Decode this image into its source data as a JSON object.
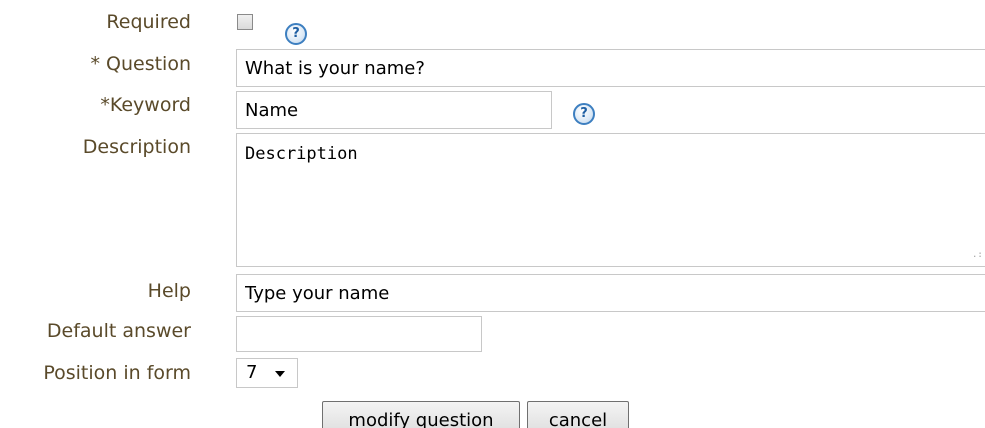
{
  "form": {
    "required": {
      "label": "Required",
      "checked": false,
      "help_icon": "question-icon"
    },
    "question": {
      "label": "* Question",
      "value": "What is your name?"
    },
    "keyword": {
      "label": "*Keyword",
      "value": "Name",
      "help_icon": "question-icon"
    },
    "description": {
      "label": "Description",
      "value": "Description"
    },
    "help": {
      "label": "Help",
      "value": "Type your name"
    },
    "default_answer": {
      "label": "Default answer",
      "value": ""
    },
    "position": {
      "label": "Position in form",
      "selected": "7"
    }
  },
  "actions": {
    "modify_label": "modify question",
    "cancel_label": "cancel"
  },
  "icons": {
    "help_glyph": "?"
  },
  "colors": {
    "label_text": "#5a4a2a",
    "help_icon_blue": "#3d7fc0",
    "field_border": "#c8c8c8"
  }
}
